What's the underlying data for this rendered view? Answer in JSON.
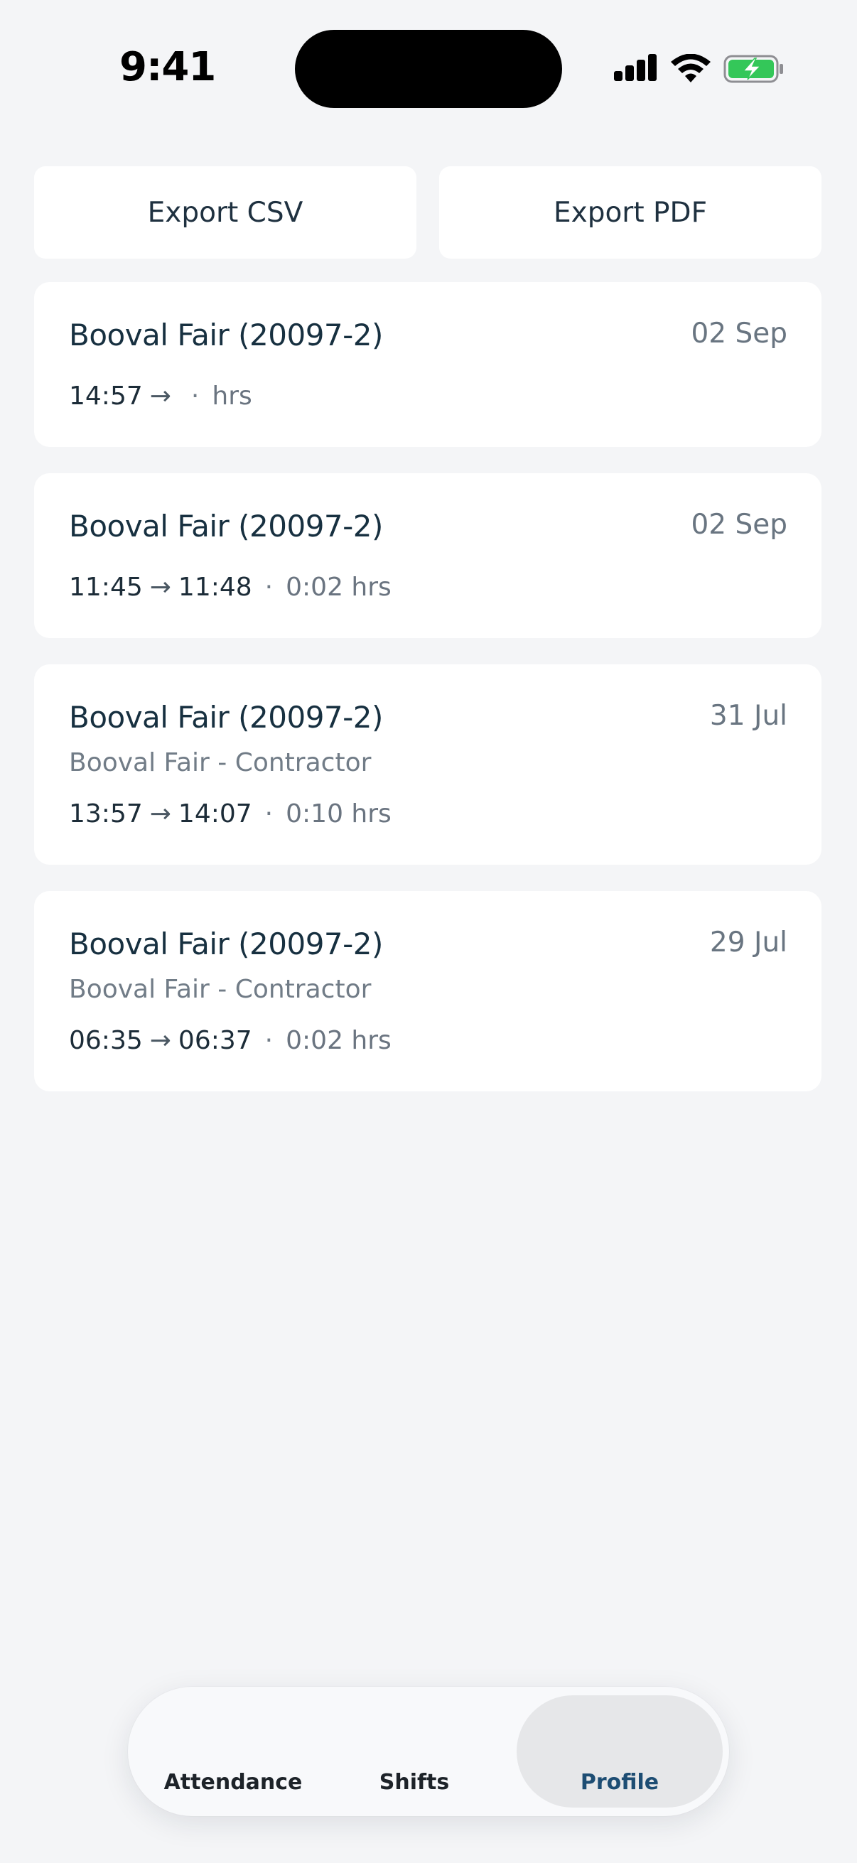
{
  "status_bar": {
    "time": "9:41"
  },
  "actions": {
    "export_csv": "Export CSV",
    "export_pdf": "Export PDF"
  },
  "entries": [
    {
      "title": "Booval Fair (20097-2)",
      "date": "02 Sep",
      "subtitle": "",
      "start": "14:57",
      "end": "",
      "duration": "hrs"
    },
    {
      "title": "Booval Fair (20097-2)",
      "date": "02 Sep",
      "subtitle": "",
      "start": "11:45",
      "end": "11:48",
      "duration": "0:02 hrs"
    },
    {
      "title": "Booval Fair (20097-2)",
      "date": "31 Jul",
      "subtitle": "Booval Fair - Contractor",
      "start": "13:57",
      "end": "14:07",
      "duration": "0:10 hrs"
    },
    {
      "title": "Booval Fair (20097-2)",
      "date": "29 Jul",
      "subtitle": "Booval Fair - Contractor",
      "start": "06:35",
      "end": "06:37",
      "duration": "0:02 hrs"
    }
  ],
  "tabs": [
    {
      "label": "Attendance",
      "active": false
    },
    {
      "label": "Shifts",
      "active": false
    },
    {
      "label": "Profile",
      "active": true
    }
  ],
  "colors": {
    "active_tab": "#1d4d73",
    "battery": "#34c759",
    "background": "#f4f5f7"
  }
}
